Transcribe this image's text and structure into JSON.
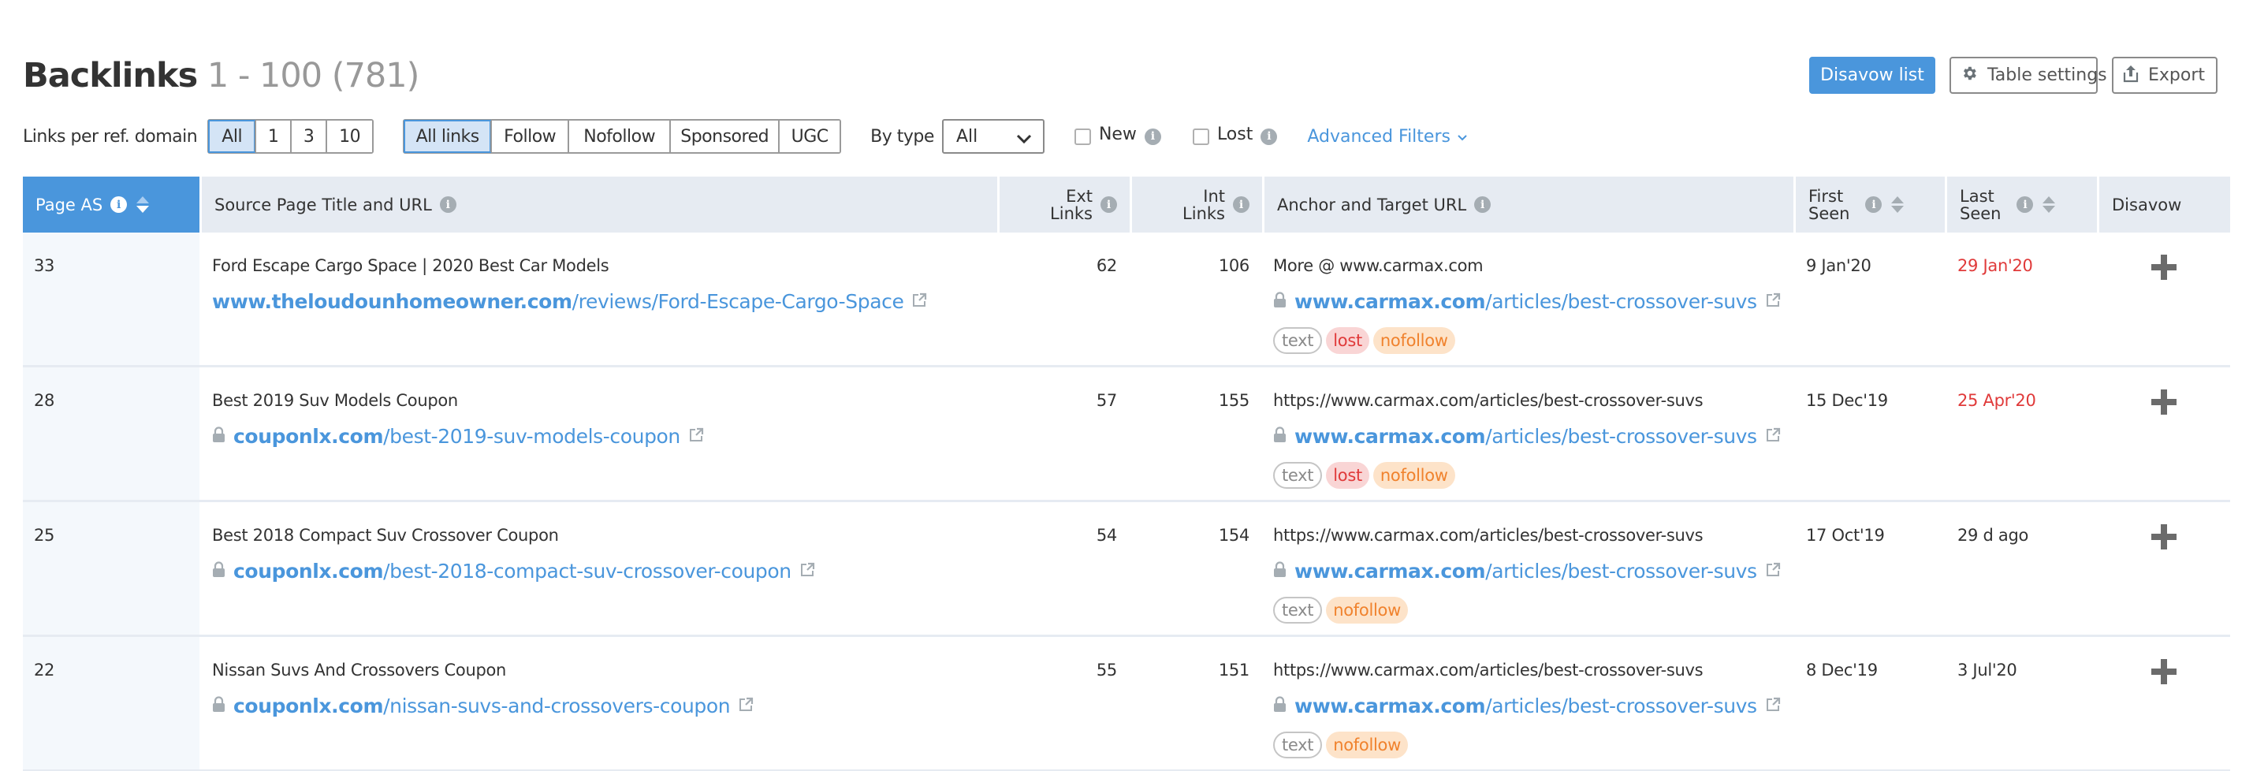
{
  "header": {
    "title": "Backlinks",
    "range": "1 - 100 (781)",
    "buttons": {
      "disavow_list": "Disavow list",
      "table_settings": "Table settings",
      "export": "Export"
    }
  },
  "filters": {
    "links_per_domain_label": "Links per ref. domain",
    "links_per_domain_options": [
      "All",
      "1",
      "3",
      "10"
    ],
    "links_per_domain_selected": "All",
    "link_type_options": [
      "All links",
      "Follow",
      "Nofollow",
      "Sponsored",
      "UGC"
    ],
    "link_type_selected": "All links",
    "by_type_label": "By type",
    "by_type_value": "All",
    "new_label": "New",
    "new_checked": false,
    "lost_label": "Lost",
    "lost_checked": false,
    "advanced_filters": "Advanced Filters"
  },
  "table": {
    "columns": {
      "page_as": "Page AS",
      "source": "Source Page Title and URL",
      "ext_links_1": "Ext",
      "ext_links_2": "Links",
      "int_links_1": "Int",
      "int_links_2": "Links",
      "anchor": "Anchor and Target URL",
      "first_seen_1": "First",
      "first_seen_2": "Seen",
      "last_seen_1": "Last",
      "last_seen_2": "Seen",
      "disavow": "Disavow"
    },
    "sorted_column": "Page AS",
    "rows": [
      {
        "page_as": "33",
        "title": "Ford Escape Cargo Space | 2020 Best Car Models",
        "source_secure": false,
        "source_domain": "www.theloudounhomeowner.com",
        "source_path": "/reviews/Ford-Escape-Cargo-Space",
        "ext_links": "62",
        "int_links": "106",
        "anchor": "More @ www.carmax.com",
        "target_domain": "www.carmax.com",
        "target_path": "/articles/best-crossover-suvs",
        "tags": [
          "text",
          "lost",
          "nofollow"
        ],
        "first_seen": "9 Jan'20",
        "last_seen": "29 Jan'20",
        "last_seen_lost": true
      },
      {
        "page_as": "28",
        "title": "Best 2019 Suv Models Coupon",
        "source_secure": true,
        "source_domain": "couponlx.com",
        "source_path": "/best-2019-suv-models-coupon",
        "ext_links": "57",
        "int_links": "155",
        "anchor": "https://www.carmax.com/articles/best-crossover-suvs",
        "target_domain": "www.carmax.com",
        "target_path": "/articles/best-crossover-suvs",
        "tags": [
          "text",
          "lost",
          "nofollow"
        ],
        "first_seen": "15 Dec'19",
        "last_seen": "25 Apr'20",
        "last_seen_lost": true
      },
      {
        "page_as": "25",
        "title": "Best 2018 Compact Suv Crossover Coupon",
        "source_secure": true,
        "source_domain": "couponlx.com",
        "source_path": "/best-2018-compact-suv-crossover-coupon",
        "ext_links": "54",
        "int_links": "154",
        "anchor": "https://www.carmax.com/articles/best-crossover-suvs",
        "target_domain": "www.carmax.com",
        "target_path": "/articles/best-crossover-suvs",
        "tags": [
          "text",
          "nofollow"
        ],
        "first_seen": "17 Oct'19",
        "last_seen": "29 d ago",
        "last_seen_lost": false
      },
      {
        "page_as": "22",
        "title": "Nissan Suvs And Crossovers Coupon",
        "source_secure": true,
        "source_domain": "couponlx.com",
        "source_path": "/nissan-suvs-and-crossovers-coupon",
        "ext_links": "55",
        "int_links": "151",
        "anchor": "https://www.carmax.com/articles/best-crossover-suvs",
        "target_domain": "www.carmax.com",
        "target_path": "/articles/best-crossover-suvs",
        "tags": [
          "text",
          "nofollow"
        ],
        "first_seen": "8 Dec'19",
        "last_seen": "3 Jul'20",
        "last_seen_lost": false
      }
    ]
  },
  "icons": {
    "info": "info-icon",
    "sort": "sort-icon",
    "lock": "lock-icon",
    "external_link": "external-link-icon",
    "plus": "plus-icon",
    "gear": "gear-icon",
    "export": "export-icon",
    "chevron_down": "chevron-down-icon"
  },
  "colors": {
    "accent": "#4a96dc",
    "lost_red": "#e03a3a",
    "nofollow_orange": "#f0822d",
    "header_bg": "#e6ebf2"
  }
}
